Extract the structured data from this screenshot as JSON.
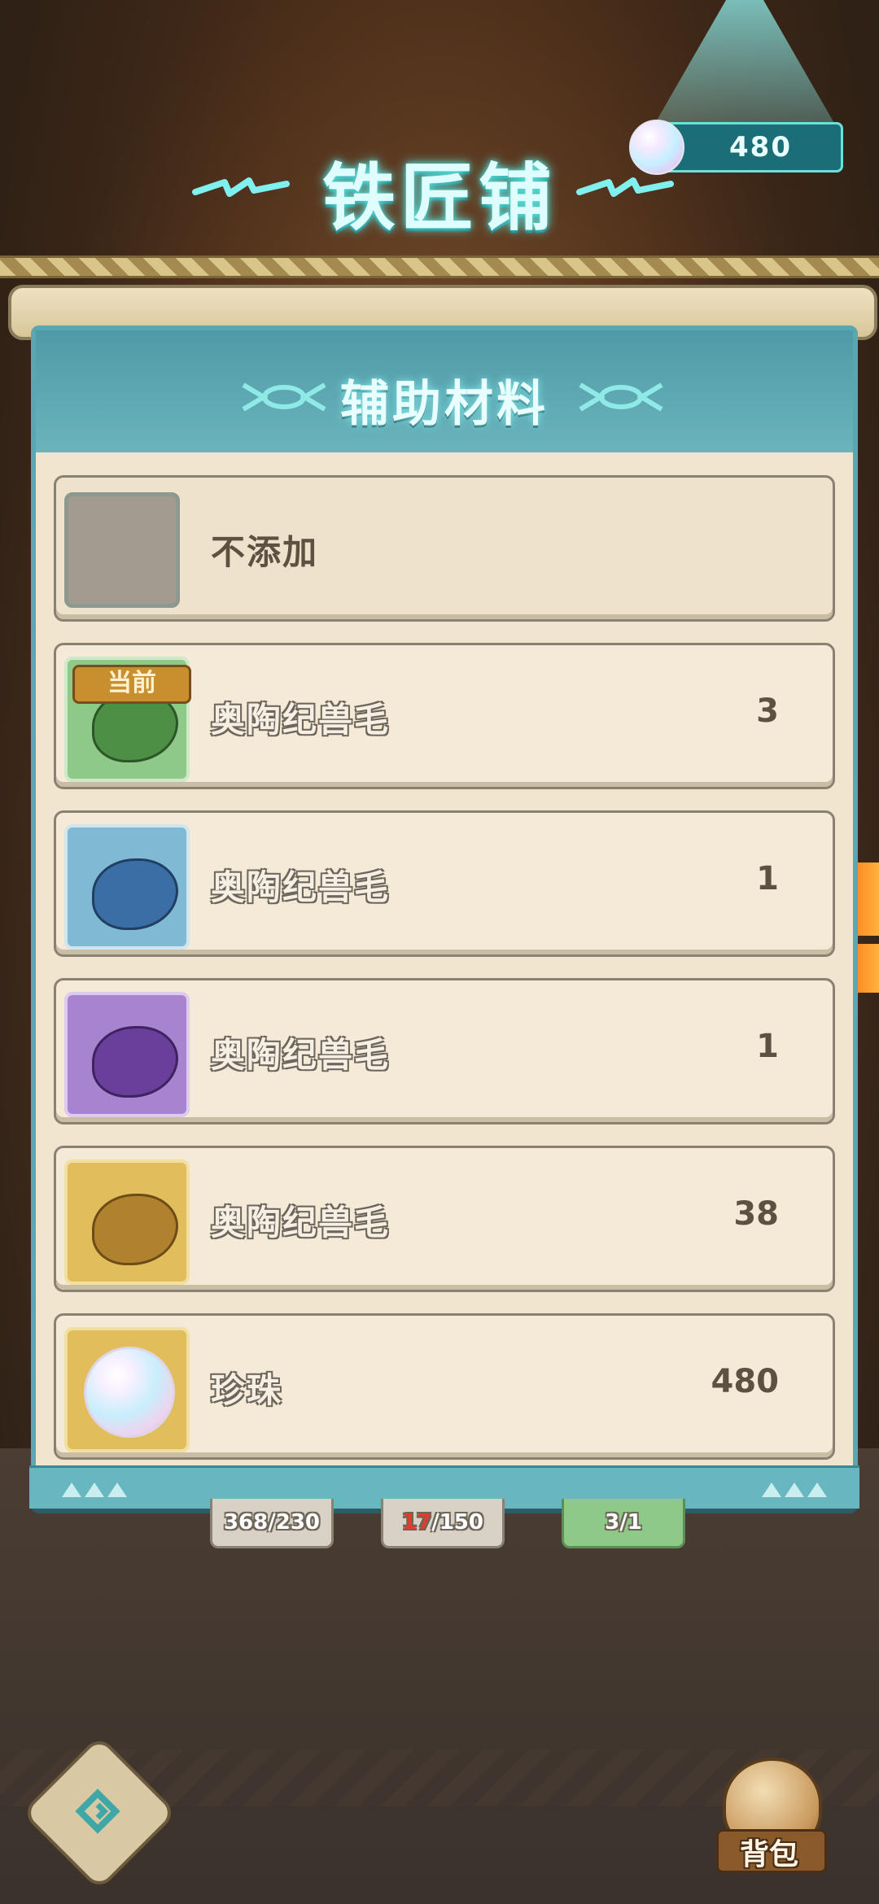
{
  "header": {
    "title": "铁匠铺",
    "currency": {
      "amount": "480",
      "icon": "pearl-icon"
    }
  },
  "panel": {
    "title": "辅助材料",
    "items": [
      {
        "name": "不添加",
        "count": "",
        "type": "empty"
      },
      {
        "name": "奥陶纪兽毛",
        "count": "3",
        "color": "#4e8f46",
        "bg": "#8fc987",
        "badge": "当前"
      },
      {
        "name": "奥陶纪兽毛",
        "count": "1",
        "color": "#3b6ea4",
        "bg": "#7fb9d4"
      },
      {
        "name": "奥陶纪兽毛",
        "count": "1",
        "color": "#6a3f9b",
        "bg": "#a884d0"
      },
      {
        "name": "奥陶纪兽毛",
        "count": "38",
        "color": "#b0822e",
        "bg": "#e2bd5c"
      },
      {
        "name": "珍珠",
        "count": "480",
        "bg": "#e2bd5c",
        "icon": "pearl-icon"
      }
    ]
  },
  "bottom_slots": [
    {
      "text": "368/230"
    },
    {
      "text": "17/150",
      "current": "17",
      "max": "/150"
    },
    {
      "text": "3/1"
    }
  ],
  "footer": {
    "back_icon": "back-icon",
    "bag_label": "背包"
  },
  "colors": {
    "accent": "#5aa7b1",
    "panel_bg": "#f1e5cf",
    "title_glow": "#5ee7e3"
  }
}
